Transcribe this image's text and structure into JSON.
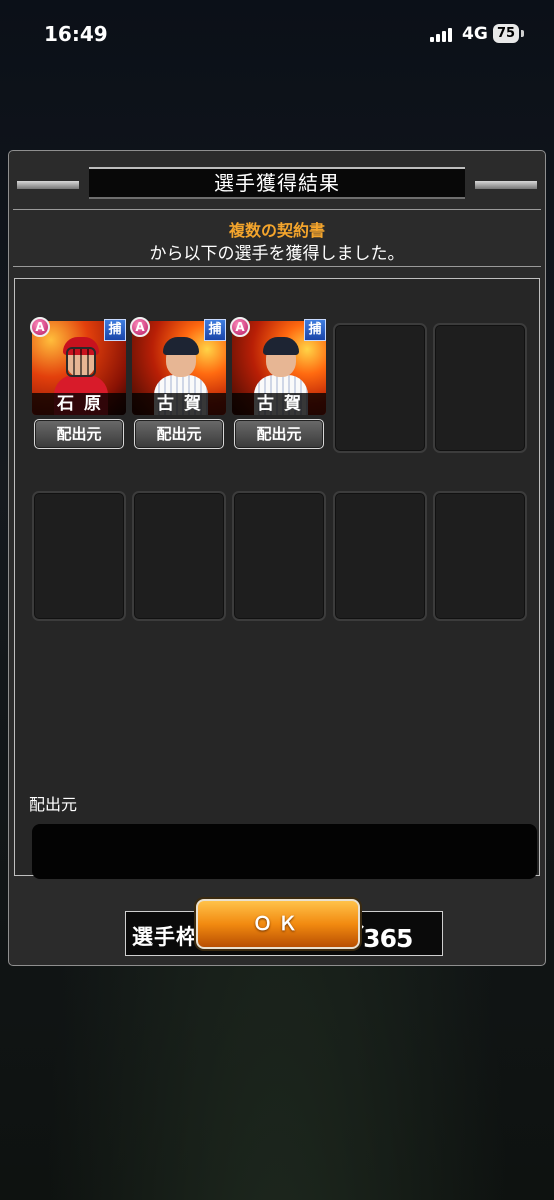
{
  "status_bar": {
    "time": "16:49",
    "network": "4G",
    "battery": "75"
  },
  "dialog": {
    "title": "選手獲得結果",
    "message_highlight": "複数の契約書",
    "message_body": "から以下の選手を獲得しました。"
  },
  "cards": [
    {
      "rank": "A",
      "position": "捕",
      "name": "石原",
      "source_button": "配出元"
    },
    {
      "rank": "A",
      "position": "捕",
      "name": "古賀",
      "source_button": "配出元"
    },
    {
      "rank": "A",
      "position": "捕",
      "name": "古賀",
      "source_button": "配出元"
    }
  ],
  "source_section": {
    "label": "配出元"
  },
  "capacity": {
    "label": "選手枠：",
    "value": "240／365"
  },
  "ok_button": {
    "label": "ＯＫ"
  },
  "colors": {
    "highlight": "#f4a52c",
    "ok_button": "#f28a10",
    "position_badge": "#2a5fd0",
    "rank_badge": "#d0207a"
  }
}
